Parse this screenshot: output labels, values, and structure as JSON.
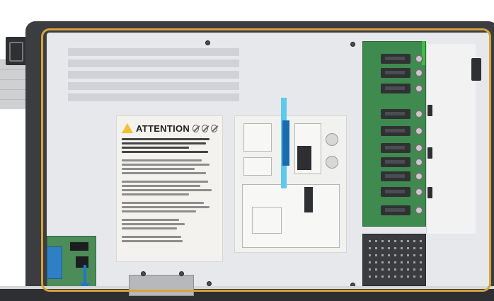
{
  "attention_label": {
    "title": "ATTENTION",
    "warning_icon": "warning-triangle-icon",
    "prohibition_icons": [
      "prohibition-icon",
      "prohibition-icon",
      "prohibition-icon"
    ]
  },
  "colors": {
    "enclosure": "#3b3d40",
    "panel": "#e7e8ec",
    "cable": "#d7a33b",
    "pcb": "#3f8a4f",
    "highlight_light": "#5ec9ee",
    "highlight_dark": "#1a6bb0",
    "arrow": "#1f77c9"
  },
  "annotations": {
    "highlight_marker": "cable-routing-highlight",
    "direction_arrow": "arrow-down-icon"
  }
}
